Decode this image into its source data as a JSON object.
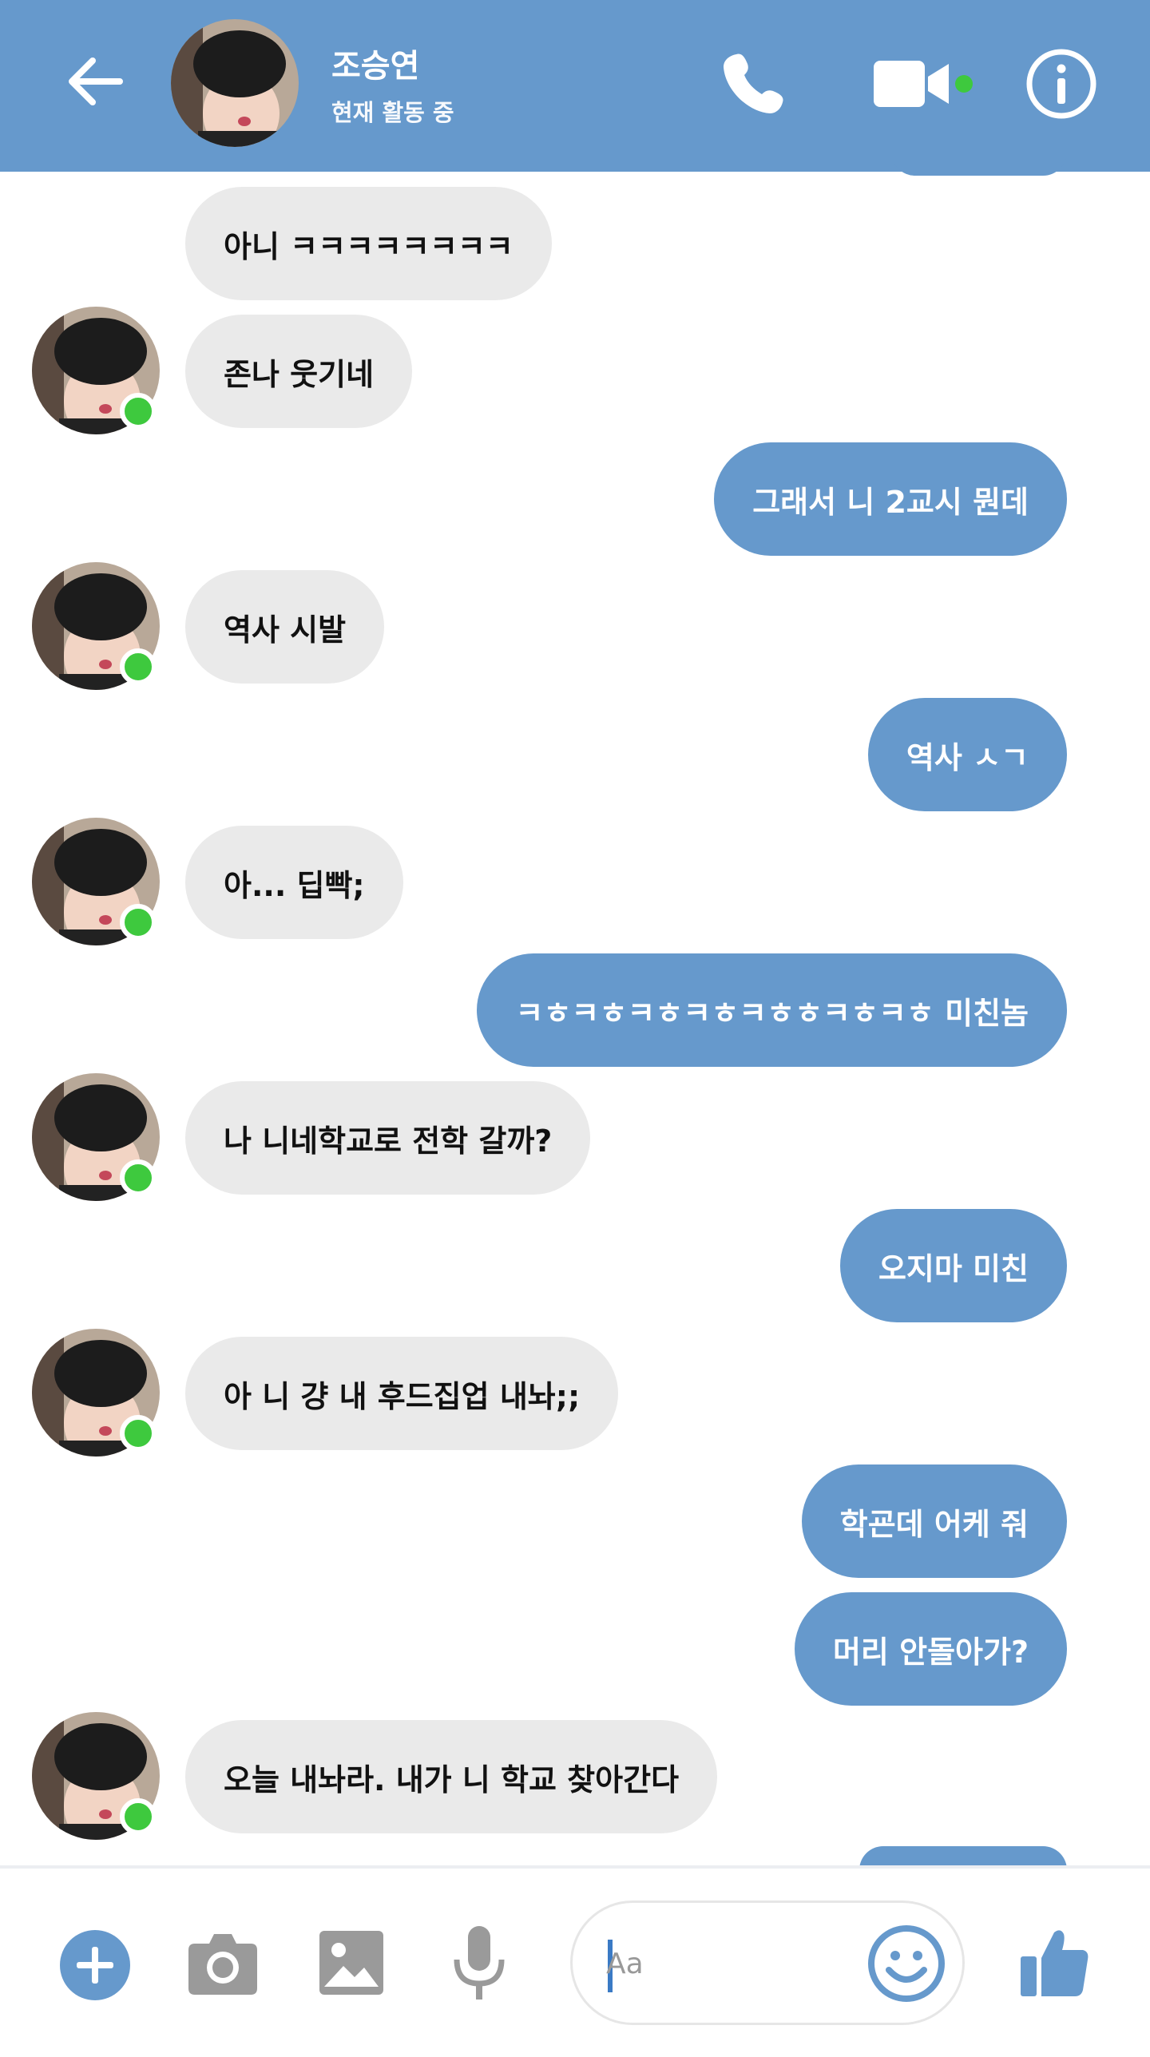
{
  "header": {
    "name": "조승연",
    "status": "현재 활동 중",
    "icons": [
      "back-arrow-icon",
      "phone-icon",
      "video-camera-icon",
      "info-icon"
    ]
  },
  "colors": {
    "accent": "#6699cc",
    "incoming_bubble": "#eaeaea",
    "online": "#3ec93e"
  },
  "messages": [
    {
      "dir": "in",
      "text": "아니 ㅋㅋㅋㅋㅋㅋㅋㅋ"
    },
    {
      "dir": "in",
      "text": "존나 웃기네"
    },
    {
      "dir": "out",
      "text": "그래서 니 2교시 뭔데"
    },
    {
      "dir": "in",
      "text": "역사 시발"
    },
    {
      "dir": "out",
      "text": "역사 ㅅㄱ"
    },
    {
      "dir": "in",
      "text": "아... 딥빡;"
    },
    {
      "dir": "out",
      "text": "ㅋㅎㅋㅎㅋㅎㅋㅎㅋㅎㅎㅋㅎㅋㅎ 미친놈"
    },
    {
      "dir": "in",
      "text": "나 니네학교로 전학 갈까?"
    },
    {
      "dir": "out",
      "text": "오지마 미친"
    },
    {
      "dir": "in",
      "text": "아 니 걍 내 후드집업 내놔;;"
    },
    {
      "dir": "out",
      "text": "학굔데 어케 줘"
    },
    {
      "dir": "out",
      "text": "머리 안돌아가?"
    },
    {
      "dir": "in",
      "text": "오늘 내놔라. 내가 니 학교 찾아간다"
    }
  ],
  "composer": {
    "placeholder": "Aa",
    "icons": [
      "add-icon",
      "camera-icon",
      "image-icon",
      "microphone-icon",
      "emoji-icon",
      "thumbs-up-icon"
    ]
  }
}
